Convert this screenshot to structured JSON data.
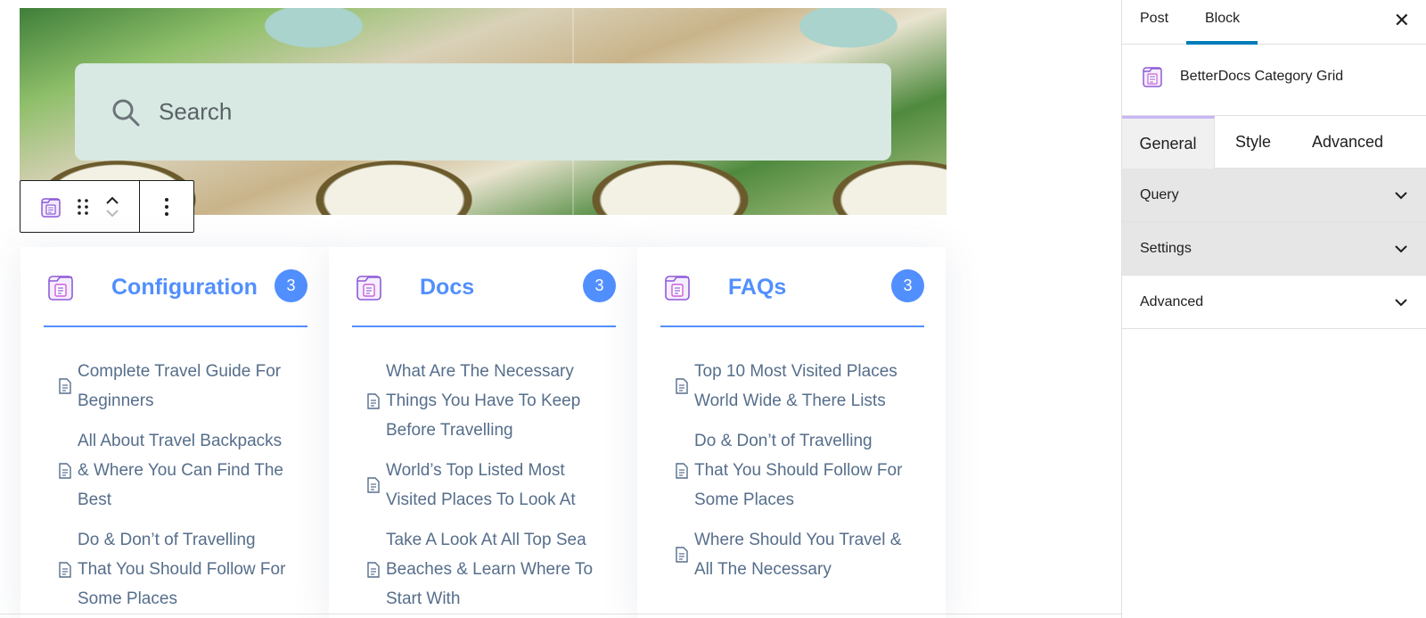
{
  "search": {
    "placeholder": "Search"
  },
  "categories": [
    {
      "title": "Configuration",
      "count": "3",
      "docs": [
        "Complete Travel Guide For Beginners",
        "All About Travel Backpacks & Where You Can Find The Best",
        "Do & Don’t of Travelling That You Should Follow For Some Places"
      ]
    },
    {
      "title": "Docs",
      "count": "3",
      "docs": [
        "What Are The Necessary Things You Have To Keep Before Travelling",
        "World’s Top Listed Most Visited Places To Look At",
        "Take A Look At All Top Sea Beaches & Learn Where To Start With"
      ]
    },
    {
      "title": "FAQs",
      "count": "3",
      "docs": [
        "Top 10 Most Visited Places World Wide & There Lists",
        "Do & Don’t of Travelling That You Should Follow For Some Places",
        "Where Should You Travel & All The Necessary"
      ]
    }
  ],
  "sidebar": {
    "tabs": [
      "Post",
      "Block"
    ],
    "active_tab": "Block",
    "block_name": "BetterDocs Category Grid",
    "inner_tabs": [
      "General",
      "Style",
      "Advanced"
    ],
    "active_inner_tab": "General",
    "panels": [
      "Query",
      "Settings",
      "Advanced"
    ]
  },
  "colors": {
    "accent": "#528ffe",
    "link": "#566e8b",
    "wp_blue": "#007cba",
    "icon_purple": "#8e5bd8",
    "search_bg": "#d8e8e3"
  },
  "icons": {
    "search": "search-icon",
    "category": "category-folder-icon",
    "drag": "drag-handle-icon",
    "doc": "document-icon",
    "close": "close-icon",
    "chevron": "chevron-down-icon"
  }
}
